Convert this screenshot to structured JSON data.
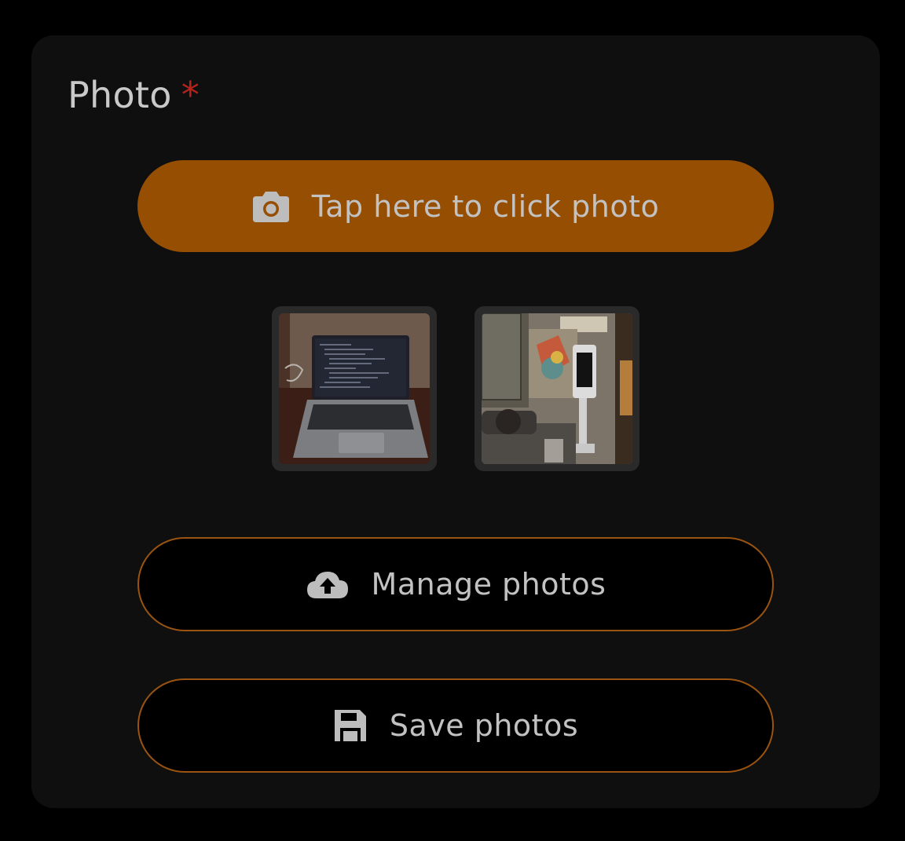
{
  "field": {
    "label": "Photo",
    "required_mark": "*"
  },
  "capture_button": {
    "label": "Tap here to click photo",
    "icon": "camera-icon"
  },
  "thumbnails": [
    {
      "description_icon": "photo-thumbnail"
    },
    {
      "description_icon": "photo-thumbnail"
    }
  ],
  "manage_button": {
    "label": "Manage photos",
    "icon": "cloud-upload-icon"
  },
  "save_button": {
    "label": "Save photos",
    "icon": "floppy-disk-icon"
  },
  "colors": {
    "background": "#000000",
    "card": "#0f0f0f",
    "accent": "#964e02",
    "outline": "#9a5411",
    "required": "#b5231c",
    "text": "#c2c2c2"
  }
}
